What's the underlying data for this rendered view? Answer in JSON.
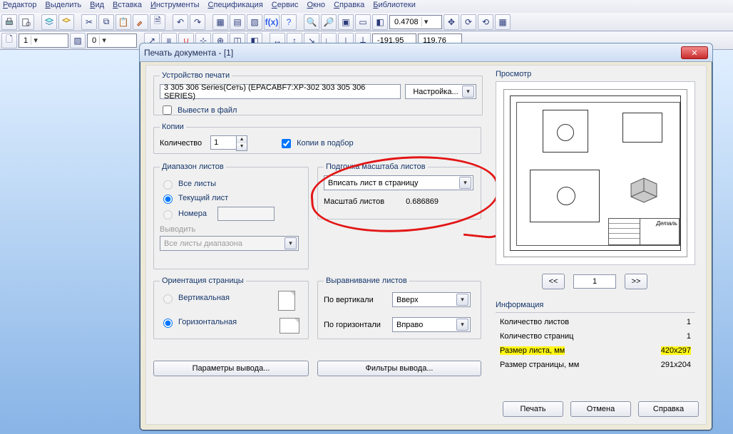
{
  "menu": [
    "Редактор",
    "Выделить",
    "Вид",
    "Вставка",
    "Инструменты",
    "Спецификация",
    "Сервис",
    "Окно",
    "Справка",
    "Библиотеки"
  ],
  "toolbar2": {
    "zoom": "0.4708",
    "coord_x": "-191.95",
    "coord_y": "119.76"
  },
  "toolbar3": {
    "layer": "1",
    "val2": "0"
  },
  "dialog": {
    "title": "Печать документа - [1]",
    "device": {
      "legend": "Устройство печати",
      "value": "3 305 306 Series(Сеть) (EPACABF7:XP-302 303 305 306 SERIES)",
      "config_btn": "Настройка...",
      "tofile": "Вывести в файл"
    },
    "copies": {
      "legend": "Копии",
      "qty_label": "Количество",
      "qty": "1",
      "collate": "Копии в подбор"
    },
    "range": {
      "legend": "Диапазон листов",
      "all": "Все листы",
      "current": "Текущий лист",
      "numbers": "Номера",
      "output_label": "Выводить",
      "output_value": "Все листы диапазона"
    },
    "fit": {
      "legend": "Подгонка масштаба листов",
      "value": "Вписать лист в страницу",
      "scale_label": "Масштаб листов",
      "scale_value": "0.686869"
    },
    "orient": {
      "legend": "Ориентация страницы",
      "vert": "Вертикальная",
      "horiz": "Горизонтальная"
    },
    "align": {
      "legend": "Выравнивание листов",
      "vlabel": "По вертикали",
      "vval": "Вверх",
      "hlabel": "По горизонтали",
      "hval": "Вправо"
    },
    "lower_btns": {
      "params": "Параметры вывода...",
      "filters": "Фильтры вывода..."
    },
    "preview": {
      "legend": "Просмотр",
      "page": "1",
      "prev": "<<",
      "next": ">>",
      "drawing_label": "Деталь"
    },
    "info": {
      "legend": "Информация",
      "rows": [
        {
          "k": "Количество листов",
          "v": "1"
        },
        {
          "k": "Количество страниц",
          "v": "1"
        },
        {
          "k": "Размер листа, мм",
          "v": "420x297"
        },
        {
          "k": "Размер страницы, мм",
          "v": "291x204"
        }
      ]
    },
    "buttons": {
      "print": "Печать",
      "cancel": "Отмена",
      "help": "Справка"
    }
  }
}
